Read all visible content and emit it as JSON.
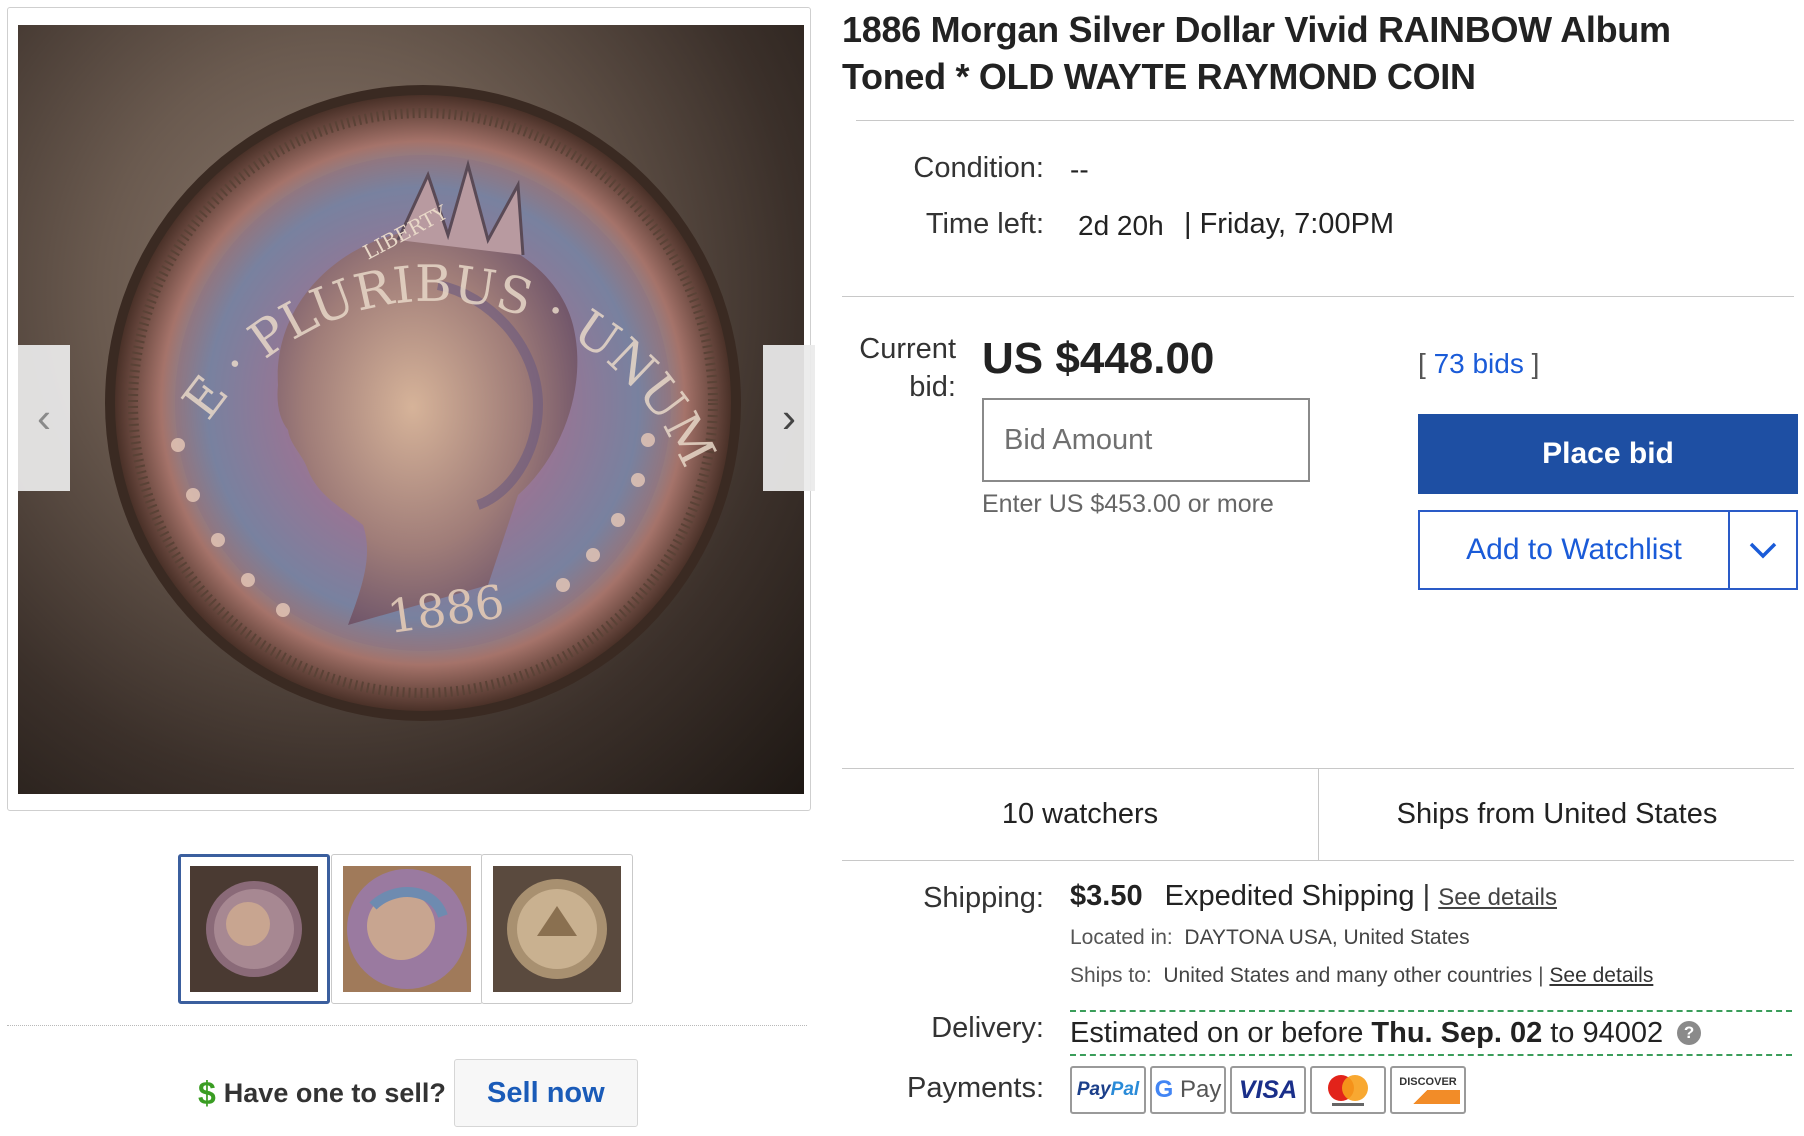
{
  "listing": {
    "title": "1886 Morgan Silver Dollar Vivid RAINBOW Album Toned * OLD WAYTE RAYMOND COIN",
    "condition_label": "Condition:",
    "condition_value": "--",
    "time_left_label": "Time left:",
    "time_left_value": "2d 20h",
    "time_left_end": "| Friday, 7:00PM"
  },
  "bid": {
    "current_label_1": "Current",
    "current_label_2": "bid:",
    "price": "US $448.00",
    "input_placeholder": "Bid Amount",
    "enter_note": "Enter US $453.00 or more",
    "bids_open": "[",
    "bids_link": "73 bids",
    "bids_close": "]",
    "place_bid_label": "Place bid",
    "watchlist_label": "Add to Watchlist"
  },
  "stats": {
    "watchers": "10 watchers",
    "ships_from": "Ships from United States"
  },
  "shipping": {
    "label": "Shipping:",
    "cost": "$3.50",
    "method": "Expedited Shipping",
    "sep": "|",
    "details_link": "See details",
    "located_label": "Located in:",
    "located_value": "DAYTONA USA, United States",
    "ships_to_label": "Ships to:",
    "ships_to_value": "United States and many other countries",
    "ships_to_sep": "|",
    "ships_to_link": "See details"
  },
  "delivery": {
    "label": "Delivery:",
    "prefix": "Estimated on or before",
    "date": "Thu. Sep. 02",
    "suffix": "to 94002",
    "help": "?"
  },
  "payments": {
    "label": "Payments:",
    "methods": [
      "PayPal",
      "G Pay",
      "VISA",
      "mastercard",
      "DISCOVER"
    ]
  },
  "image": {
    "coin_legend": "E · PLURIBUS · UNUM",
    "coin_year": "1886",
    "coin_liberty": "LIBERTY"
  },
  "sell": {
    "dollar": "$",
    "question": "Have one to sell?",
    "button": "Sell now"
  }
}
